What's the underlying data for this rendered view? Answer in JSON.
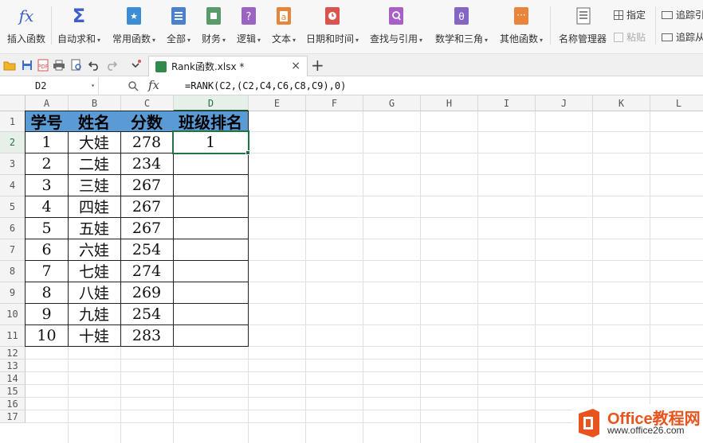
{
  "ribbon": {
    "insert_function": "插入函数",
    "autosum": "自动求和",
    "common_functions": "常用函数",
    "all": "全部",
    "finance": "财务",
    "logic": "逻辑",
    "text": "文本",
    "datetime": "日期和时间",
    "lookup": "查找与引用",
    "math": "数学和三角",
    "other": "其他函数",
    "name_manager": "名称管理器",
    "specify": "指定",
    "paste": "粘贴",
    "trace_precedents": "追踪引",
    "trace_dependents": "追踪从",
    "icon_letters": {
      "text": "a",
      "lookup": "Q",
      "math": "θ"
    },
    "colors": {
      "autosum": "#3d5fc7",
      "common": "#3b8ed6",
      "all": "#4b7fd0",
      "finance": "#5b9a6a",
      "logic": "#9a63c4",
      "text": "#e8853a",
      "datetime": "#d9534f",
      "lookup": "#a860c8",
      "math": "#8465c4",
      "other": "#e8853a"
    }
  },
  "tabbar": {
    "doc_title": "Rank函数.xlsx *",
    "close": "×",
    "new_tab": "+"
  },
  "formula_bar": {
    "name_box": "D2",
    "fx": "fx",
    "formula": "=RANK(C2,(C2,C4,C6,C8,C9),0)"
  },
  "sheet": {
    "columns": [
      "A",
      "B",
      "C",
      "D",
      "E",
      "F",
      "G",
      "H",
      "I",
      "J",
      "K",
      "L"
    ],
    "rows": [
      "1",
      "2",
      "3",
      "4",
      "5",
      "6",
      "7",
      "8",
      "9",
      "10",
      "11",
      "12",
      "13",
      "14",
      "15",
      "16",
      "17"
    ],
    "active_cell": "D2",
    "header": [
      "学号",
      "姓名",
      "分数",
      "班级排名"
    ],
    "data": [
      [
        "1",
        "大娃",
        "278",
        "1"
      ],
      [
        "2",
        "二娃",
        "234",
        ""
      ],
      [
        "3",
        "三娃",
        "267",
        ""
      ],
      [
        "4",
        "四娃",
        "267",
        ""
      ],
      [
        "5",
        "五娃",
        "267",
        ""
      ],
      [
        "6",
        "六娃",
        "254",
        ""
      ],
      [
        "7",
        "七娃",
        "274",
        ""
      ],
      [
        "8",
        "八娃",
        "269",
        ""
      ],
      [
        "9",
        "九娃",
        "254",
        ""
      ],
      [
        "10",
        "十娃",
        "283",
        ""
      ]
    ],
    "header_fill": "#5b9bd5",
    "selection_color": "#217346"
  },
  "watermark": {
    "brand": "Office教程网",
    "url": "www.office26.com"
  }
}
